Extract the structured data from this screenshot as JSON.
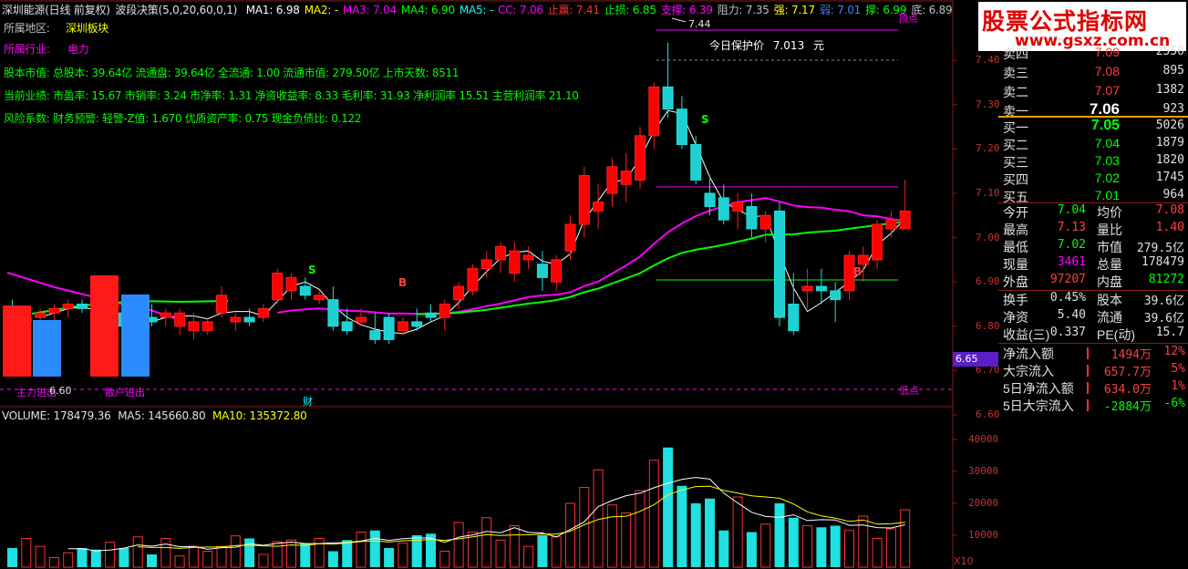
{
  "header": {
    "stock": "深圳能源(日线 前复权)",
    "indicator": "波段决策(5,0,20,60,0,1)",
    "items": [
      {
        "text": "MA1: 6.98",
        "color": "#ffffff"
      },
      {
        "text": "MA2: -",
        "color": "#ffff00"
      },
      {
        "text": "MA3: 7.04",
        "color": "#ff00ff"
      },
      {
        "text": "MA4: 6.90",
        "color": "#00ff00"
      },
      {
        "text": "MA5: -",
        "color": "#00ffff"
      },
      {
        "text": "CC: 7.06",
        "color": "#ff00ff"
      },
      {
        "text": "止赢: 7.41",
        "color": "#ff3030"
      },
      {
        "text": "止损: 6.85",
        "color": "#00ff00"
      },
      {
        "text": "支撑: 6.39",
        "color": "#ff00ff"
      },
      {
        "text": "阻力: 7.35",
        "color": "#c0c0c0"
      },
      {
        "text": "强: 7.17",
        "color": "#ffff00"
      },
      {
        "text": "弱: 7.01",
        "color": "#4080ff"
      },
      {
        "text": "撑: 6.99",
        "color": "#00ff00"
      },
      {
        "text": "底: 6.89",
        "color": "#c0c0c0"
      }
    ]
  },
  "info": {
    "region_label": "所属地区:",
    "region_value": "深圳板块",
    "industry_label": "所属行业:",
    "industry_value": "电力",
    "equity": "股本市值: 总股本: 39.64亿 流通盘: 39.64亿 全流通: 1.00 流通市值: 279.50亿 上市天数: 8511",
    "performance": "当前业绩: 市盈率: 15.67 市销率: 3.24 市净率: 1.31 净资收益率: 8.33 毛利率: 31.93 净利润率 15.51 主营利润率 21.10",
    "risk": "风险系数: 财务预警: 轻警-Z值: 1.670 优质资产率: 0.75 现金负债比: 0.122"
  },
  "annotations": {
    "high_price": "7.44",
    "protect_label": "今日保护价",
    "protect_value": "7.013",
    "protect_unit": "元",
    "main_force": "主力进出",
    "retail": "散户进出",
    "low_label": "低点",
    "high_label": "顶点",
    "cai": "财",
    "sell_mark": "S",
    "buy_mark": "B",
    "inner_value": "6.60",
    "cur_price_tag": "6.65",
    "x10": "X10"
  },
  "price_axis": [
    "7.40",
    "7.30",
    "7.20",
    "7.10",
    "7.00",
    "6.90",
    "6.80",
    "6.70",
    "6.60"
  ],
  "volume": {
    "label": "VOLUME: 178479.36",
    "ma5": "MA5: 145660.80",
    "ma10": "MA10: 135372.80",
    "axis": [
      "40000",
      "30000",
      "20000",
      "10000"
    ]
  },
  "logo": {
    "title": "股票公式指标网",
    "url": "www.gsxz.com.cn"
  },
  "orderbook": {
    "asks": [
      {
        "label": "卖四",
        "price": "7.09",
        "vol": "2550"
      },
      {
        "label": "卖三",
        "price": "7.08",
        "vol": "895"
      },
      {
        "label": "卖二",
        "price": "7.07",
        "vol": "1382"
      },
      {
        "label": "卖一",
        "price": "7.06",
        "vol": "923"
      }
    ],
    "bids": [
      {
        "label": "买一",
        "price": "7.05",
        "vol": "5026"
      },
      {
        "label": "买二",
        "price": "7.04",
        "vol": "1879"
      },
      {
        "label": "买三",
        "price": "7.03",
        "vol": "1820"
      },
      {
        "label": "买四",
        "price": "7.02",
        "vol": "1745"
      },
      {
        "label": "买五",
        "price": "7.01",
        "vol": "964"
      }
    ]
  },
  "quote": [
    {
      "a": "今开",
      "b": "7.04",
      "bc": "#00ff00",
      "c": "均价",
      "d": "7.08",
      "dc": "#ff4040"
    },
    {
      "a": "最高",
      "b": "7.13",
      "bc": "#ff4040",
      "c": "量比",
      "d": "1.40",
      "dc": "#ff4040"
    },
    {
      "a": "最低",
      "b": "7.02",
      "bc": "#00ff00",
      "c": "市值",
      "d": "279.5亿",
      "dc": "#e0e0e0"
    },
    {
      "a": "现量",
      "b": "3461",
      "bc": "#ff00ff",
      "c": "总量",
      "d": "178479",
      "dc": "#e0e0e0"
    },
    {
      "a": "外盘",
      "b": "97207",
      "bc": "#ff4040",
      "c": "内盘",
      "d": "81272",
      "dc": "#00ff00"
    }
  ],
  "fundamentals": [
    {
      "a": "换手",
      "b": "0.45%",
      "bc": "#e0e0e0",
      "c": "股本",
      "d": "39.6亿",
      "dc": "#e0e0e0"
    },
    {
      "a": "净资",
      "b": "5.40",
      "bc": "#e0e0e0",
      "c": "流通",
      "d": "39.6亿",
      "dc": "#e0e0e0"
    },
    {
      "a": "收益(三)",
      "b": "0.337",
      "bc": "#e0e0e0",
      "c": "PE(动)",
      "d": "15.7",
      "dc": "#e0e0e0"
    }
  ],
  "flows": [
    {
      "a": "净流入额",
      "b": "1494万",
      "bc": "#ff4040",
      "c": "12%",
      "cc": "#ff4040"
    },
    {
      "a": "大宗流入",
      "b": "657.7万",
      "bc": "#ff4040",
      "c": "5%",
      "cc": "#ff4040"
    },
    {
      "a": "5日净流入额",
      "b": "634.0万",
      "bc": "#ff4040",
      "c": "1%",
      "cc": "#ff4040"
    },
    {
      "a": "5日大宗流入",
      "b": "-2884万",
      "bc": "#00ff00",
      "c": "-6%",
      "cc": "#00ff00"
    }
  ],
  "chart_data": {
    "type": "candlestick",
    "ylim": [
      6.6,
      7.44
    ],
    "candles": [
      [
        6.84,
        6.86,
        6.8,
        6.81
      ],
      [
        6.81,
        6.84,
        6.78,
        6.82
      ],
      [
        6.82,
        6.84,
        6.8,
        6.83
      ],
      [
        6.83,
        6.85,
        6.81,
        6.84
      ],
      [
        6.84,
        6.86,
        6.82,
        6.85
      ],
      [
        6.85,
        6.86,
        6.83,
        6.84
      ],
      [
        6.84,
        6.85,
        6.81,
        6.82
      ],
      [
        6.82,
        6.84,
        6.8,
        6.83
      ],
      [
        6.83,
        6.84,
        6.79,
        6.8
      ],
      [
        6.8,
        6.83,
        6.79,
        6.82
      ],
      [
        6.82,
        6.85,
        6.8,
        6.81
      ],
      [
        6.82,
        6.84,
        6.8,
        6.83
      ],
      [
        6.8,
        6.84,
        6.78,
        6.83
      ],
      [
        6.79,
        6.83,
        6.77,
        6.81
      ],
      [
        6.79,
        6.82,
        6.78,
        6.81
      ],
      [
        6.83,
        6.89,
        6.82,
        6.87
      ],
      [
        6.81,
        6.83,
        6.79,
        6.82
      ],
      [
        6.82,
        6.84,
        6.8,
        6.81
      ],
      [
        6.82,
        6.85,
        6.81,
        6.84
      ],
      [
        6.86,
        6.93,
        6.85,
        6.92
      ],
      [
        6.88,
        6.92,
        6.86,
        6.91
      ],
      [
        6.89,
        6.91,
        6.86,
        6.87
      ],
      [
        6.86,
        6.88,
        6.85,
        6.87
      ],
      [
        6.86,
        6.89,
        6.79,
        6.8
      ],
      [
        6.81,
        6.84,
        6.78,
        6.79
      ],
      [
        6.81,
        6.84,
        6.8,
        6.82
      ],
      [
        6.79,
        6.83,
        6.76,
        6.77
      ],
      [
        6.82,
        6.83,
        6.76,
        6.77
      ],
      [
        6.79,
        6.82,
        6.78,
        6.81
      ],
      [
        6.81,
        6.84,
        6.79,
        6.8
      ],
      [
        6.83,
        6.85,
        6.81,
        6.82
      ],
      [
        6.82,
        6.86,
        6.79,
        6.85
      ],
      [
        6.86,
        6.9,
        6.84,
        6.89
      ],
      [
        6.88,
        6.94,
        6.87,
        6.93
      ],
      [
        6.93,
        6.97,
        6.91,
        6.95
      ],
      [
        6.95,
        6.99,
        6.92,
        6.98
      ],
      [
        6.92,
        6.99,
        6.9,
        6.97
      ],
      [
        6.95,
        6.98,
        6.93,
        6.96
      ],
      [
        6.94,
        6.97,
        6.88,
        6.91
      ],
      [
        6.9,
        6.96,
        6.88,
        6.95
      ],
      [
        6.97,
        7.05,
        6.95,
        7.03
      ],
      [
        7.03,
        7.16,
        7.0,
        7.14
      ],
      [
        7.06,
        7.12,
        7.02,
        7.08
      ],
      [
        7.1,
        7.18,
        7.07,
        7.16
      ],
      [
        7.12,
        7.19,
        7.08,
        7.15
      ],
      [
        7.13,
        7.25,
        7.11,
        7.23
      ],
      [
        7.23,
        7.35,
        7.2,
        7.34
      ],
      [
        7.34,
        7.44,
        7.27,
        7.29
      ],
      [
        7.29,
        7.32,
        7.2,
        7.21
      ],
      [
        7.21,
        7.23,
        7.12,
        7.13
      ],
      [
        7.1,
        7.14,
        7.05,
        7.07
      ],
      [
        7.09,
        7.12,
        7.03,
        7.04
      ],
      [
        7.06,
        7.1,
        7.02,
        7.08
      ],
      [
        7.07,
        7.1,
        7.0,
        7.02
      ],
      [
        7.02,
        7.06,
        6.99,
        7.05
      ],
      [
        7.06,
        7.08,
        6.8,
        6.82
      ],
      [
        6.85,
        6.92,
        6.78,
        6.79
      ],
      [
        6.88,
        6.93,
        6.84,
        6.89
      ],
      [
        6.89,
        6.93,
        6.85,
        6.88
      ],
      [
        6.88,
        6.9,
        6.81,
        6.86
      ],
      [
        6.88,
        6.97,
        6.86,
        6.96
      ],
      [
        6.94,
        6.98,
        6.9,
        6.96
      ],
      [
        6.95,
        7.04,
        6.93,
        7.03
      ],
      [
        7.02,
        7.06,
        7.0,
        7.04
      ],
      [
        7.02,
        7.13,
        7.02,
        7.06
      ]
    ],
    "volumes": [
      6000,
      9000,
      6500,
      3000,
      4500,
      6000,
      5500,
      7800,
      6000,
      9500,
      4000,
      9000,
      3500,
      6500,
      5000,
      6500,
      9800,
      9000,
      4000,
      8000,
      8500,
      7500,
      9000,
      5000,
      8500,
      11000,
      11500,
      6000,
      7500,
      10000,
      10500,
      5000,
      14000,
      11000,
      15500,
      8500,
      13000,
      6500,
      10000,
      9500,
      20000,
      25000,
      30500,
      19500,
      17000,
      24000,
      33500,
      37500,
      25500,
      20000,
      21500,
      11500,
      22000,
      11000,
      13500,
      20000,
      15500,
      13000,
      12500,
      13000,
      11500,
      16000,
      9000,
      12000,
      18000
    ]
  }
}
